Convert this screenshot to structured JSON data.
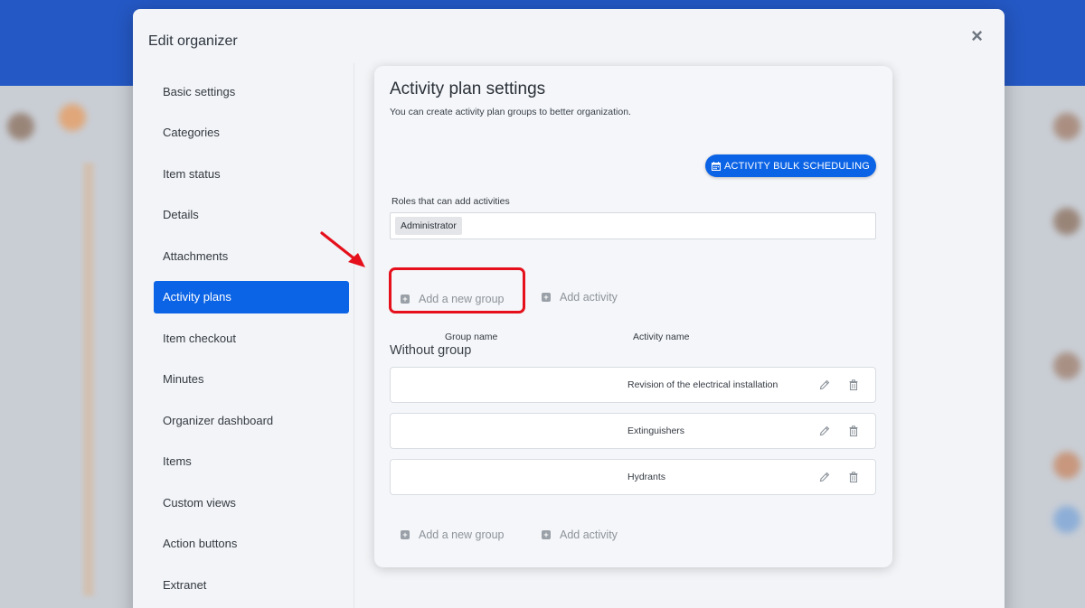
{
  "modal": {
    "title": "Edit organizer",
    "close_label": "×"
  },
  "sidebar": {
    "items": [
      {
        "label": "Basic settings",
        "active": false
      },
      {
        "label": "Categories",
        "active": false
      },
      {
        "label": "Item status",
        "active": false
      },
      {
        "label": "Details",
        "active": false
      },
      {
        "label": "Attachments",
        "active": false
      },
      {
        "label": "Activity plans",
        "active": true
      },
      {
        "label": "Item checkout",
        "active": false
      },
      {
        "label": "Minutes",
        "active": false
      },
      {
        "label": "Organizer dashboard",
        "active": false
      },
      {
        "label": "Items",
        "active": false
      },
      {
        "label": "Custom views",
        "active": false
      },
      {
        "label": "Action buttons",
        "active": false
      },
      {
        "label": "Extranet",
        "active": false
      }
    ]
  },
  "panel": {
    "title": "Activity plan settings",
    "subtitle": "You can create activity plan groups to better organization.",
    "bulk_button_label": "ACTIVITY BULK SCHEDULING",
    "roles_label": "Roles that can add activities",
    "roles": [
      "Administrator"
    ],
    "add_group_label": "Add a new group",
    "add_activity_label": "Add activity",
    "columns": {
      "group_name": "Group name",
      "activity_name": "Activity name"
    },
    "group_heading": "Without group",
    "activities": [
      {
        "name": "Revision of the electrical installation"
      },
      {
        "name": "Extinguishers"
      },
      {
        "name": "Hydrants"
      }
    ]
  },
  "colors": {
    "accent": "#0b63e5",
    "highlight": "#e5101b",
    "arrow": "#e5101b"
  },
  "icons": {
    "close": "close-icon",
    "calendar": "calendar-icon",
    "plus": "plus-square-icon",
    "edit": "pencil-icon",
    "delete": "trash-icon",
    "arrow": "annotation-arrow"
  }
}
